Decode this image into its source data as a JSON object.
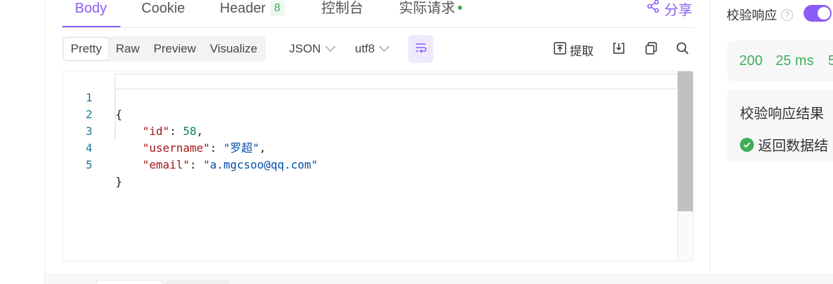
{
  "tabs": [
    {
      "label": "Body",
      "active": true
    },
    {
      "label": "Cookie"
    },
    {
      "label": "Header",
      "badge": "8"
    },
    {
      "label": "控制台"
    },
    {
      "label": "实际请求"
    }
  ],
  "share_label": "分享",
  "view_modes": [
    {
      "label": "Pretty",
      "active": true
    },
    {
      "label": "Raw"
    },
    {
      "label": "Preview"
    },
    {
      "label": "Visualize"
    }
  ],
  "format_select": "JSON",
  "encoding_select": "utf8",
  "toolbar": {
    "extract_label": "提取"
  },
  "editor": {
    "lines": [
      {
        "num": "1",
        "text": "{"
      },
      {
        "num": "2",
        "key": "\"id\"",
        "value": "58",
        "value_type": "number",
        "trail": ","
      },
      {
        "num": "3",
        "key": "\"username\"",
        "value": "\"罗超\"",
        "value_type": "string",
        "trail": ","
      },
      {
        "num": "4",
        "key": "\"email\"",
        "value": "\"a.mgcsoo@qq.com\"",
        "value_type": "string",
        "trail": ""
      },
      {
        "num": "5",
        "text": "}"
      }
    ]
  },
  "right_panel": {
    "verify_label": "校验响应",
    "verify_enabled": true,
    "status_code": "200",
    "time": "25 ms",
    "size_partial": "5",
    "result_title": "校验响应结果",
    "result_text": "返回数据结"
  },
  "colors": {
    "accent": "#8b5cf6",
    "success": "#3fae5a"
  }
}
